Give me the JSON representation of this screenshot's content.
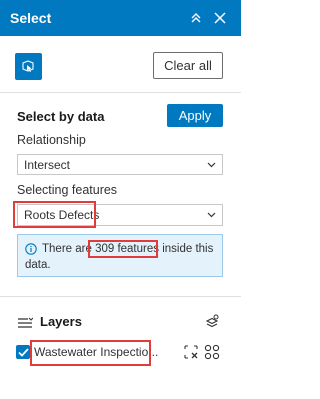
{
  "header": {
    "title": "Select"
  },
  "toolbar": {
    "clear_label": "Clear all"
  },
  "select_by_data": {
    "title": "Select by data",
    "apply_label": "Apply",
    "relationship_label": "Relationship",
    "relationship_value": "Intersect",
    "selecting_features_label": "Selecting features",
    "selecting_features_value": "Roots Defects"
  },
  "info": {
    "prefix": "There are",
    "count": "309 features",
    "suffix": "inside this",
    "line2": "data."
  },
  "layers": {
    "title": "Layers",
    "items": [
      {
        "name": "Wastewater Inspectio...",
        "checked": true
      }
    ]
  },
  "colors": {
    "brand": "#0079c1",
    "highlight": "#e03c3c",
    "info_bg": "#e3f2fb"
  }
}
